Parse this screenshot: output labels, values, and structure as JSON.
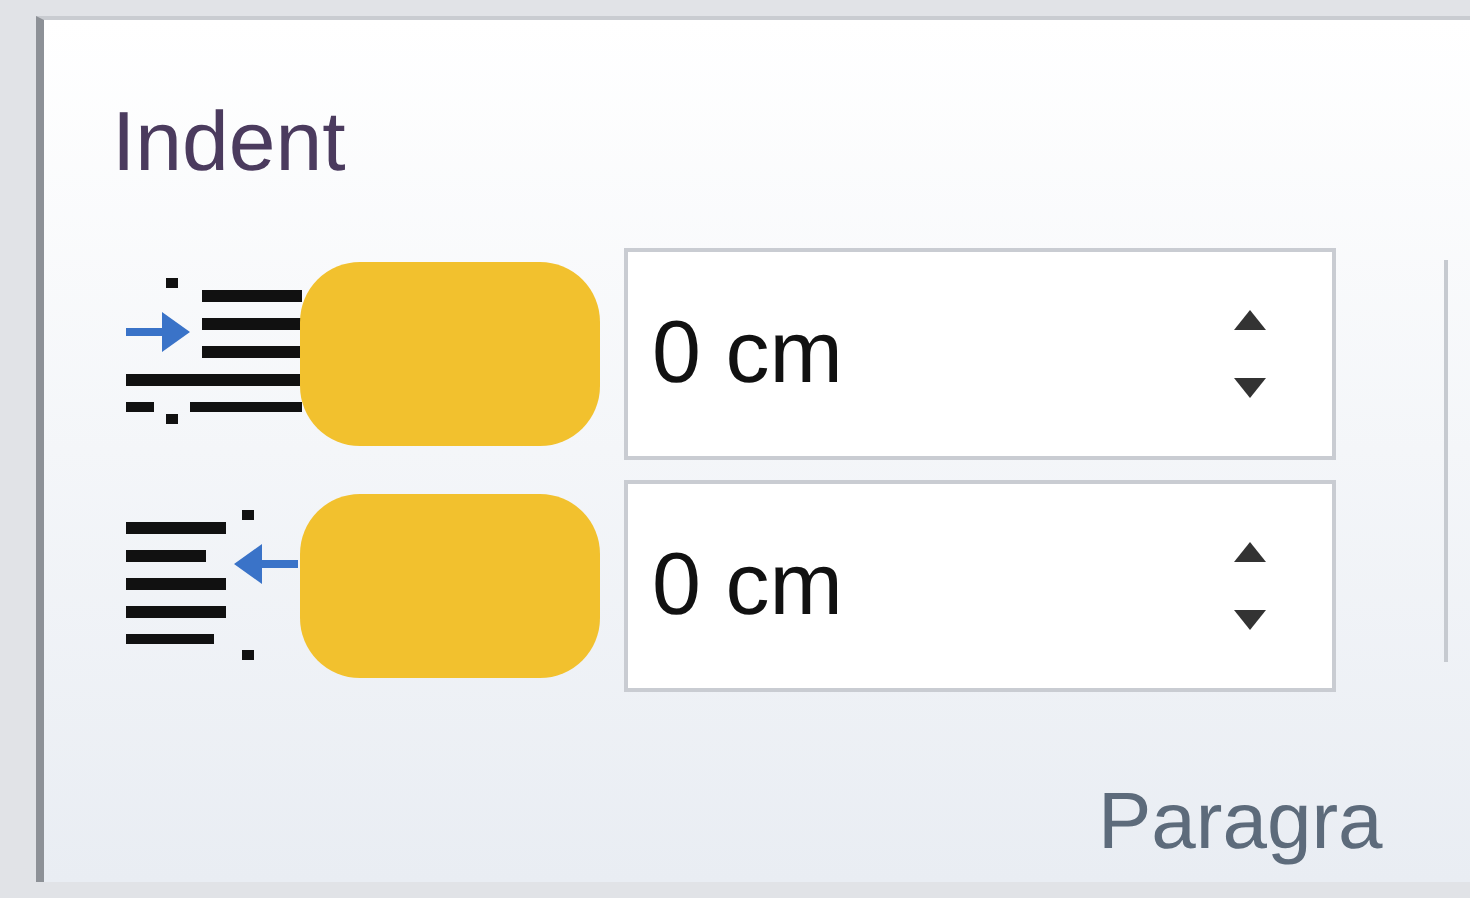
{
  "group": {
    "title": "Indent",
    "footer": "Paragra"
  },
  "fields": [
    {
      "kind": "left",
      "value": "0 cm"
    },
    {
      "kind": "right",
      "value": "0 cm"
    }
  ]
}
